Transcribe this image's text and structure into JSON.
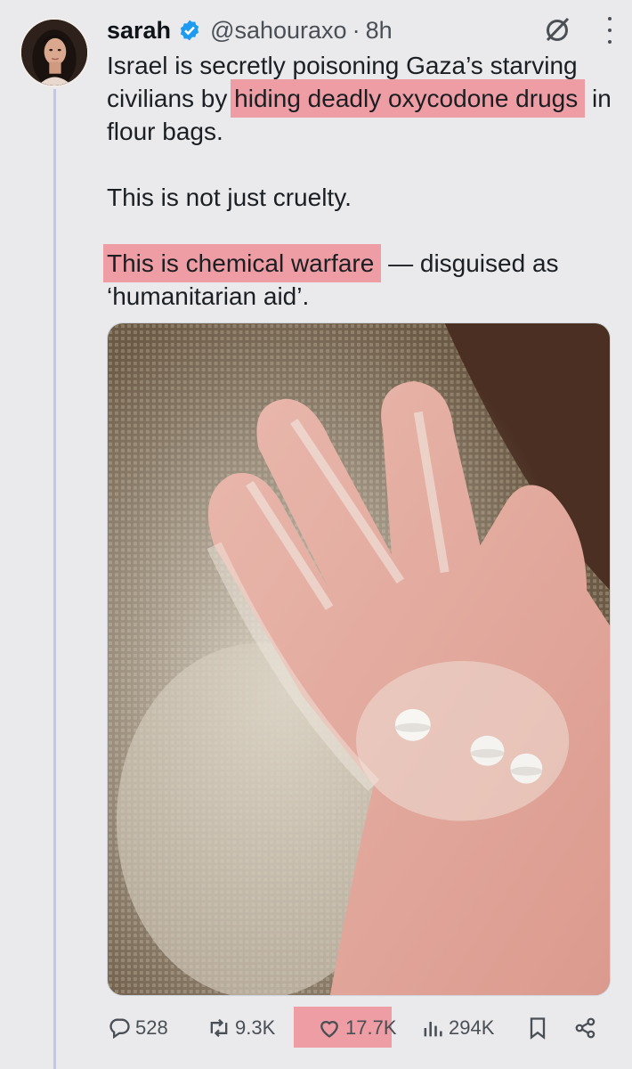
{
  "author": {
    "name": "sarah",
    "handle": "@sahouraxo",
    "separator": "·",
    "time": "8h"
  },
  "icons": {
    "verified": "verified-badge-icon",
    "grok": "grok-icon",
    "more": "more-options-icon",
    "reply": "reply-icon",
    "retweet": "retweet-icon",
    "like": "heart-icon",
    "views": "views-chart-icon",
    "bookmark": "bookmark-icon",
    "share": "share-icon"
  },
  "tweet": {
    "line1_pre": "Israel is secretly poisoning Gaza’s starving civilians by ",
    "line1_hl": "hiding deadly oxycodone drugs",
    "line1_post": " in flour bags.",
    "line2": "This is not just cruelty.",
    "line3_hl": "This is chemical warfare",
    "line3_post": " — disguised as ‘humanitarian aid’."
  },
  "stats": {
    "replies": "528",
    "retweets": "9.3K",
    "likes": "17.7K",
    "views": "294K"
  },
  "colors": {
    "highlight": "#ee5c68",
    "verified": "#1d9bf0",
    "background": "#eaeaec"
  }
}
